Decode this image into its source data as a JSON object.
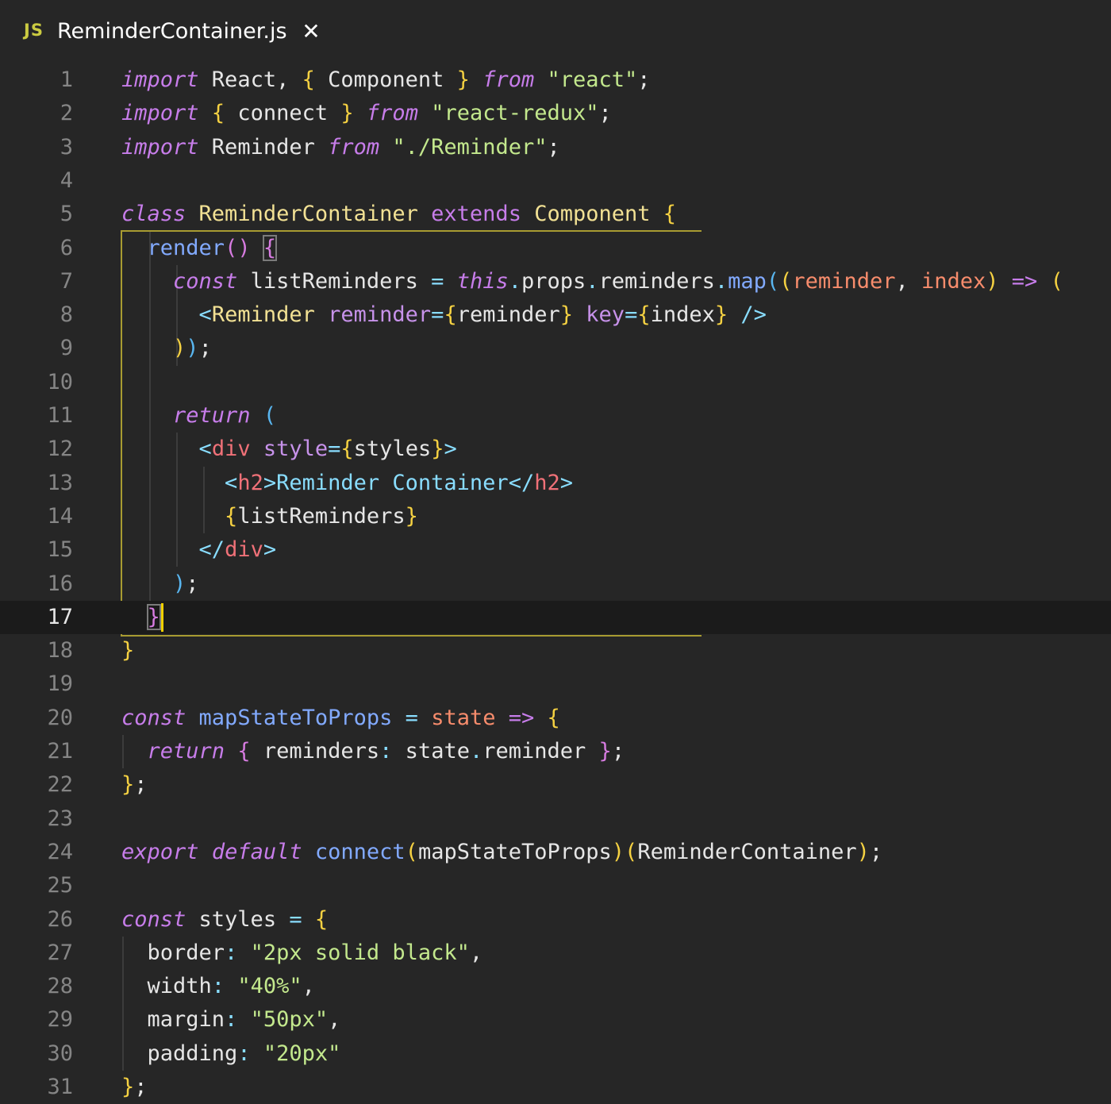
{
  "tab": {
    "icon_label": "JS",
    "title": "ReminderContainer.js",
    "close_icon": "close-icon"
  },
  "editor": {
    "current_line": 17,
    "line_numbers": [
      "1",
      "2",
      "3",
      "4",
      "5",
      "6",
      "7",
      "8",
      "9",
      "10",
      "11",
      "12",
      "13",
      "14",
      "15",
      "16",
      "17",
      "18",
      "19",
      "20",
      "21",
      "22",
      "23",
      "24",
      "25",
      "26",
      "27",
      "28",
      "29",
      "30",
      "31"
    ],
    "lines": [
      [
        [
          "kw",
          "import"
        ],
        [
          "plain",
          " React, "
        ],
        [
          "b1",
          "{"
        ],
        [
          "plain",
          " Component "
        ],
        [
          "b1",
          "}"
        ],
        [
          "plain",
          " "
        ],
        [
          "kw",
          "from"
        ],
        [
          "plain",
          " "
        ],
        [
          "str",
          "\"react\""
        ],
        [
          "plain",
          ";"
        ]
      ],
      [
        [
          "kw",
          "import"
        ],
        [
          "plain",
          " "
        ],
        [
          "b1",
          "{"
        ],
        [
          "plain",
          " connect "
        ],
        [
          "b1",
          "}"
        ],
        [
          "plain",
          " "
        ],
        [
          "kw",
          "from"
        ],
        [
          "plain",
          " "
        ],
        [
          "str",
          "\"react-redux\""
        ],
        [
          "plain",
          ";"
        ]
      ],
      [
        [
          "kw",
          "import"
        ],
        [
          "plain",
          " Reminder "
        ],
        [
          "kw",
          "from"
        ],
        [
          "plain",
          " "
        ],
        [
          "str",
          "\"./Reminder\""
        ],
        [
          "plain",
          ";"
        ]
      ],
      [],
      [
        [
          "kw",
          "class"
        ],
        [
          "plain",
          " "
        ],
        [
          "cls",
          "ReminderContainer"
        ],
        [
          "plain",
          " "
        ],
        [
          "kwn",
          "extends"
        ],
        [
          "plain",
          " "
        ],
        [
          "cls",
          "Component"
        ],
        [
          "plain",
          " "
        ],
        [
          "b1",
          "{"
        ]
      ],
      [
        [
          "plain",
          "  "
        ],
        [
          "fn",
          "render"
        ],
        [
          "b2",
          "()"
        ],
        [
          "plain",
          " "
        ],
        [
          "b2box",
          "{"
        ]
      ],
      [
        [
          "plain",
          "    "
        ],
        [
          "kw",
          "const"
        ],
        [
          "plain",
          " listReminders "
        ],
        [
          "op",
          "="
        ],
        [
          "plain",
          " "
        ],
        [
          "kw",
          "this"
        ],
        [
          "op",
          "."
        ],
        [
          "plain",
          "props"
        ],
        [
          "op",
          "."
        ],
        [
          "plain",
          "reminders"
        ],
        [
          "op",
          "."
        ],
        [
          "fn",
          "map"
        ],
        [
          "b3",
          "("
        ],
        [
          "b1",
          "("
        ],
        [
          "par",
          "reminder"
        ],
        [
          "plain",
          ", "
        ],
        [
          "par",
          "index"
        ],
        [
          "b1",
          ")"
        ],
        [
          "plain",
          " "
        ],
        [
          "kwn",
          "=>"
        ],
        [
          "plain",
          " "
        ],
        [
          "b1",
          "("
        ]
      ],
      [
        [
          "plain",
          "      "
        ],
        [
          "tagp",
          "<"
        ],
        [
          "cls",
          "Reminder"
        ],
        [
          "plain",
          " "
        ],
        [
          "attr",
          "reminder"
        ],
        [
          "op",
          "="
        ],
        [
          "b1",
          "{"
        ],
        [
          "plain",
          "reminder"
        ],
        [
          "b1",
          "}"
        ],
        [
          "plain",
          " "
        ],
        [
          "attr",
          "key"
        ],
        [
          "op",
          "="
        ],
        [
          "b1",
          "{"
        ],
        [
          "plain",
          "index"
        ],
        [
          "b1",
          "}"
        ],
        [
          "plain",
          " "
        ],
        [
          "tagp",
          "/>"
        ]
      ],
      [
        [
          "plain",
          "    "
        ],
        [
          "b1",
          ")"
        ],
        [
          "b3",
          ")"
        ],
        [
          "plain",
          ";"
        ]
      ],
      [],
      [
        [
          "plain",
          "    "
        ],
        [
          "kw",
          "return"
        ],
        [
          "plain",
          " "
        ],
        [
          "b3",
          "("
        ]
      ],
      [
        [
          "plain",
          "      "
        ],
        [
          "tagp",
          "<"
        ],
        [
          "tag",
          "div"
        ],
        [
          "plain",
          " "
        ],
        [
          "attr",
          "style"
        ],
        [
          "op",
          "="
        ],
        [
          "b1",
          "{"
        ],
        [
          "plain",
          "styles"
        ],
        [
          "b1",
          "}"
        ],
        [
          "tagp",
          ">"
        ]
      ],
      [
        [
          "plain",
          "        "
        ],
        [
          "tagp",
          "<"
        ],
        [
          "tag",
          "h2"
        ],
        [
          "tagp",
          ">"
        ],
        [
          "txt",
          "Reminder Container"
        ],
        [
          "tagp",
          "</"
        ],
        [
          "tag",
          "h2"
        ],
        [
          "tagp",
          ">"
        ]
      ],
      [
        [
          "plain",
          "        "
        ],
        [
          "b1",
          "{"
        ],
        [
          "plain",
          "listReminders"
        ],
        [
          "b1",
          "}"
        ]
      ],
      [
        [
          "plain",
          "      "
        ],
        [
          "tagp",
          "</"
        ],
        [
          "tag",
          "div"
        ],
        [
          "tagp",
          ">"
        ]
      ],
      [
        [
          "plain",
          "    "
        ],
        [
          "b3",
          ")"
        ],
        [
          "plain",
          ";"
        ]
      ],
      [
        [
          "plain",
          "  "
        ],
        [
          "b2box",
          "}"
        ],
        [
          "cursor",
          ""
        ]
      ],
      [
        [
          "b1",
          "}"
        ]
      ],
      [],
      [
        [
          "kw",
          "const"
        ],
        [
          "plain",
          " "
        ],
        [
          "fn",
          "mapStateToProps"
        ],
        [
          "plain",
          " "
        ],
        [
          "op",
          "="
        ],
        [
          "plain",
          " "
        ],
        [
          "par",
          "state"
        ],
        [
          "plain",
          " "
        ],
        [
          "kwn",
          "=>"
        ],
        [
          "plain",
          " "
        ],
        [
          "b1",
          "{"
        ]
      ],
      [
        [
          "plain",
          "  "
        ],
        [
          "kw",
          "return"
        ],
        [
          "plain",
          " "
        ],
        [
          "b2",
          "{"
        ],
        [
          "plain",
          " reminders"
        ],
        [
          "op",
          ":"
        ],
        [
          "plain",
          " state"
        ],
        [
          "op",
          "."
        ],
        [
          "plain",
          "reminder "
        ],
        [
          "b2",
          "}"
        ],
        [
          "plain",
          ";"
        ]
      ],
      [
        [
          "b1",
          "}"
        ],
        [
          "plain",
          ";"
        ]
      ],
      [],
      [
        [
          "kw",
          "export"
        ],
        [
          "plain",
          " "
        ],
        [
          "kw",
          "default"
        ],
        [
          "plain",
          " "
        ],
        [
          "fn",
          "connect"
        ],
        [
          "b1",
          "("
        ],
        [
          "plain",
          "mapStateToProps"
        ],
        [
          "b1",
          ")"
        ],
        [
          "b1",
          "("
        ],
        [
          "plain",
          "ReminderContainer"
        ],
        [
          "b1",
          ")"
        ],
        [
          "plain",
          ";"
        ]
      ],
      [],
      [
        [
          "kw",
          "const"
        ],
        [
          "plain",
          " styles "
        ],
        [
          "op",
          "="
        ],
        [
          "plain",
          " "
        ],
        [
          "b1",
          "{"
        ]
      ],
      [
        [
          "plain",
          "  border"
        ],
        [
          "op",
          ":"
        ],
        [
          "plain",
          " "
        ],
        [
          "str",
          "\"2px solid black\""
        ],
        [
          "plain",
          ","
        ]
      ],
      [
        [
          "plain",
          "  width"
        ],
        [
          "op",
          ":"
        ],
        [
          "plain",
          " "
        ],
        [
          "str",
          "\"40%\""
        ],
        [
          "plain",
          ","
        ]
      ],
      [
        [
          "plain",
          "  margin"
        ],
        [
          "op",
          ":"
        ],
        [
          "plain",
          " "
        ],
        [
          "str",
          "\"50px\""
        ],
        [
          "plain",
          ","
        ]
      ],
      [
        [
          "plain",
          "  padding"
        ],
        [
          "op",
          ":"
        ],
        [
          "plain",
          " "
        ],
        [
          "str",
          "\"20px\""
        ]
      ],
      [
        [
          "b1",
          "}"
        ],
        [
          "plain",
          ";"
        ]
      ]
    ]
  }
}
